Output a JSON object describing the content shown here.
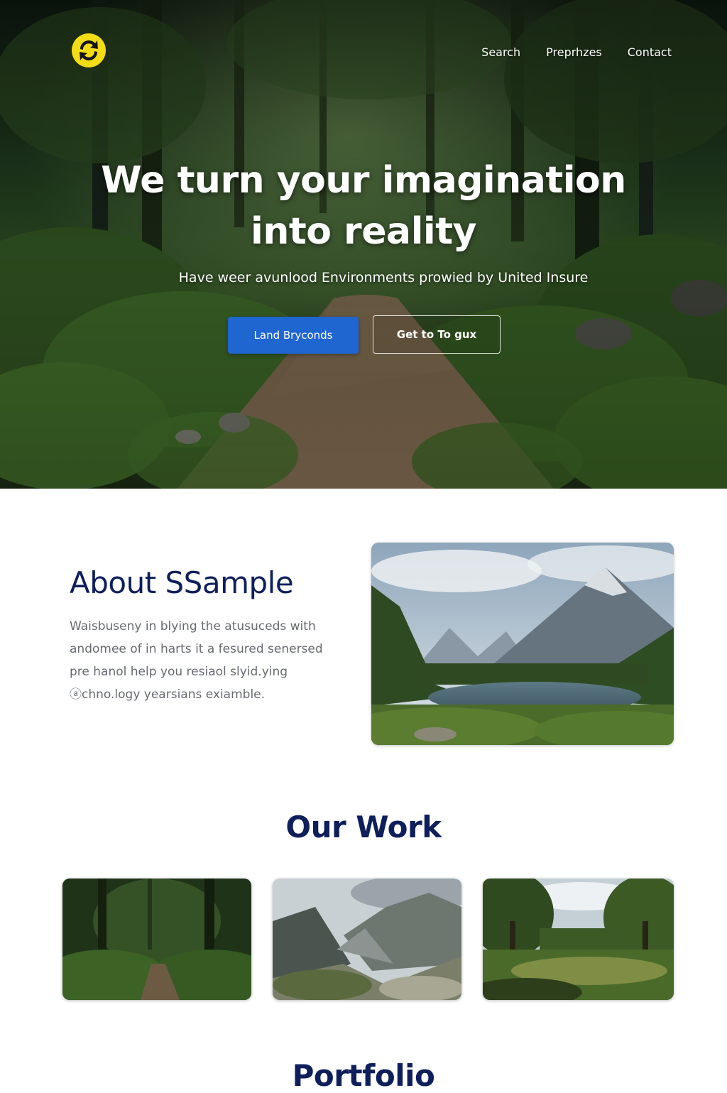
{
  "header": {
    "nav": [
      {
        "label": "Search"
      },
      {
        "label": "Preprhzes"
      },
      {
        "label": "Contact"
      }
    ]
  },
  "colors": {
    "logo": "#f2dc14",
    "primary_button": "#1f66d1",
    "heading": "#0e1f5c",
    "body_text": "#666a70"
  },
  "hero": {
    "title_line1": "We turn your imagination",
    "title_line2": "into reality",
    "subtitle": "Have weer avunlood Environments prowied by United Insure",
    "primary_button_label": "Land Bryconds",
    "secondary_button_label": "Get to To gux"
  },
  "about": {
    "title": "About SSample",
    "lines": [
      "Waisbuseny in blying the atusuceds with",
      "andomee of in harts it a fesured senersed",
      "pre hanol help you resiaol slyid.ying",
      "ⓐchno.logy yearsians exiamble."
    ]
  },
  "work": {
    "title": "Our Work"
  },
  "portfolio": {
    "title": "Portfolio"
  }
}
